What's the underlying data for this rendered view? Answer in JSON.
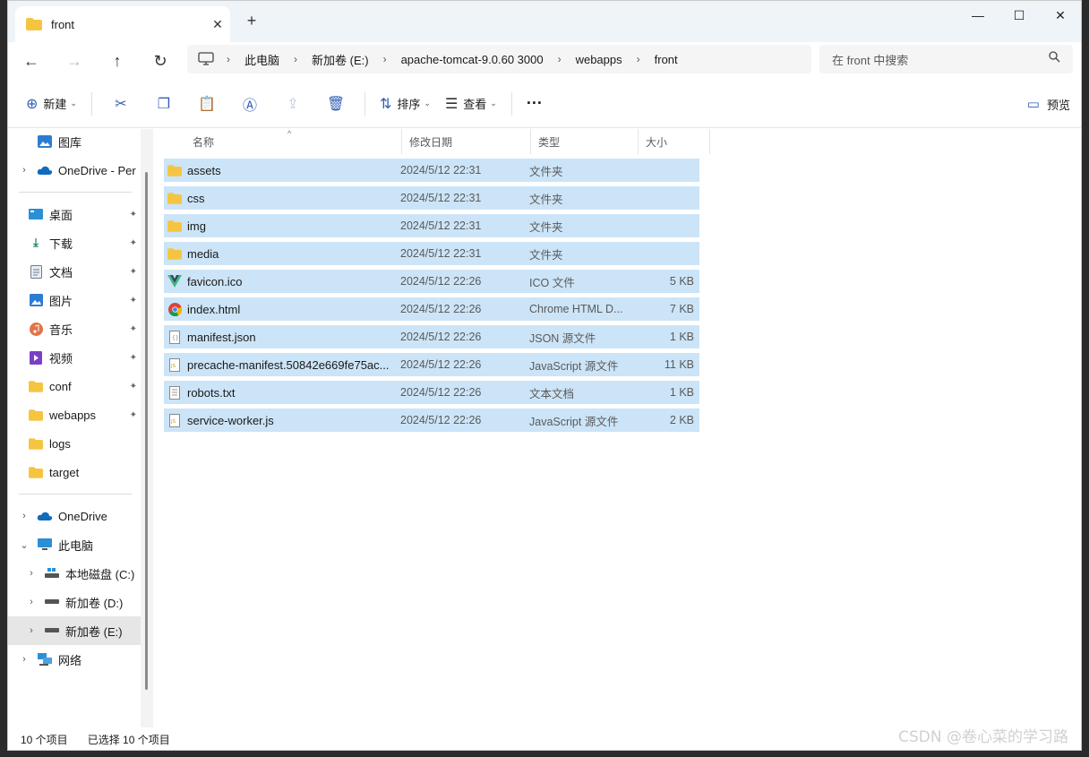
{
  "tab": {
    "title": "front",
    "close": "✕",
    "new": "+"
  },
  "window_controls": {
    "minimize": "—",
    "maximize": "☐",
    "close": "✕"
  },
  "nav": {
    "back": "←",
    "forward": "→",
    "up": "↑",
    "refresh": "↻"
  },
  "address": {
    "crumbs": [
      "此电脑",
      "新加卷 (E:)",
      "apache-tomcat-9.0.60 3000",
      "webapps",
      "front"
    ],
    "sep": "›"
  },
  "search": {
    "placeholder": "在 front 中搜索"
  },
  "toolbar": {
    "new_label": "新建",
    "sort_label": "排序",
    "view_label": "查看",
    "more": "···",
    "preview_label": "预览"
  },
  "sidebar": {
    "top": [
      {
        "label": "图库",
        "icon": "gallery-icon"
      },
      {
        "label": "OneDrive - Per",
        "icon": "onedrive-icon",
        "chevron": "›"
      }
    ],
    "quick": [
      {
        "label": "桌面",
        "icon": "desktop-icon",
        "pin": "📌"
      },
      {
        "label": "下载",
        "icon": "download-icon",
        "pin": "📌"
      },
      {
        "label": "文档",
        "icon": "documents-icon",
        "pin": "📌"
      },
      {
        "label": "图片",
        "icon": "pictures-icon",
        "pin": "📌"
      },
      {
        "label": "音乐",
        "icon": "music-icon",
        "pin": "📌"
      },
      {
        "label": "视频",
        "icon": "video-icon",
        "pin": "📌"
      },
      {
        "label": "conf",
        "icon": "folder-icon",
        "pin": "📌"
      },
      {
        "label": "webapps",
        "icon": "folder-icon",
        "pin": "📌"
      },
      {
        "label": "logs",
        "icon": "folder-icon"
      },
      {
        "label": "target",
        "icon": "folder-icon"
      }
    ],
    "tree": [
      {
        "label": "OneDrive",
        "icon": "onedrive-icon",
        "chevron": "›"
      },
      {
        "label": "此电脑",
        "icon": "pc-icon",
        "chevron": "⌄"
      },
      {
        "label": "本地磁盘 (C:)",
        "icon": "drive-icon",
        "chevron": "›"
      },
      {
        "label": "新加卷 (D:)",
        "icon": "drive-icon",
        "chevron": "›"
      },
      {
        "label": "新加卷 (E:)",
        "icon": "drive-icon",
        "chevron": "›",
        "selected": true
      },
      {
        "label": "网络",
        "icon": "network-icon",
        "chevron": "›"
      }
    ]
  },
  "columns": {
    "name": "名称",
    "date": "修改日期",
    "type": "类型",
    "size": "大小",
    "sort_indicator": "^"
  },
  "files": [
    {
      "name": "assets",
      "date": "2024/5/12 22:31",
      "type": "文件夹",
      "size": "",
      "icon": "folder-icon"
    },
    {
      "name": "css",
      "date": "2024/5/12 22:31",
      "type": "文件夹",
      "size": "",
      "icon": "folder-icon"
    },
    {
      "name": "img",
      "date": "2024/5/12 22:31",
      "type": "文件夹",
      "size": "",
      "icon": "folder-icon"
    },
    {
      "name": "media",
      "date": "2024/5/12 22:31",
      "type": "文件夹",
      "size": "",
      "icon": "folder-icon"
    },
    {
      "name": "favicon.ico",
      "date": "2024/5/12 22:26",
      "type": "ICO 文件",
      "size": "5 KB",
      "icon": "vue-icon"
    },
    {
      "name": "index.html",
      "date": "2024/5/12 22:26",
      "type": "Chrome HTML D...",
      "size": "7 KB",
      "icon": "chrome-icon"
    },
    {
      "name": "manifest.json",
      "date": "2024/5/12 22:26",
      "type": "JSON 源文件",
      "size": "1 KB",
      "icon": "json-file-icon"
    },
    {
      "name": "precache-manifest.50842e669fe75ac...",
      "date": "2024/5/12 22:26",
      "type": "JavaScript 源文件",
      "size": "11 KB",
      "icon": "js-file-icon"
    },
    {
      "name": "robots.txt",
      "date": "2024/5/12 22:26",
      "type": "文本文档",
      "size": "1 KB",
      "icon": "text-file-icon"
    },
    {
      "name": "service-worker.js",
      "date": "2024/5/12 22:26",
      "type": "JavaScript 源文件",
      "size": "2 KB",
      "icon": "js-file-icon"
    }
  ],
  "status": {
    "count": "10 个项目",
    "selected": "已选择 10 个项目"
  },
  "watermark": "CSDN @卷心菜的学习路",
  "colors": {
    "selection": "#cce4f7",
    "folder": "#f5c542",
    "accent": "#2f5fb3"
  }
}
